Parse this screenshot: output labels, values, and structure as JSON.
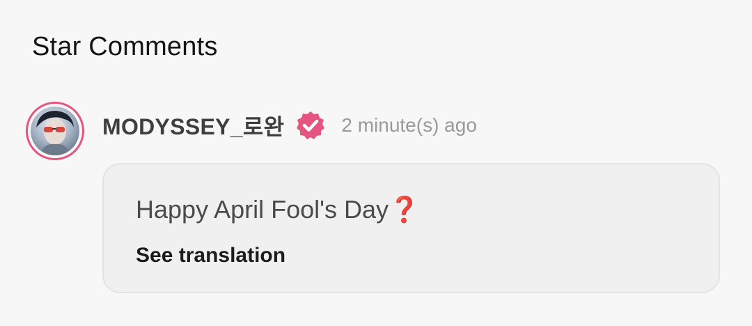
{
  "section": {
    "title": "Star Comments"
  },
  "comment": {
    "username": "MODYSSEY_로완",
    "verified_icon": "verified-badge-icon",
    "timestamp": "2 minute(s) ago",
    "text": "Happy April Fool's Day❓",
    "translate_label": "See translation"
  },
  "colors": {
    "accent": "#e4557f",
    "background": "#f7f7f7",
    "bubble": "#f0f0f0"
  }
}
